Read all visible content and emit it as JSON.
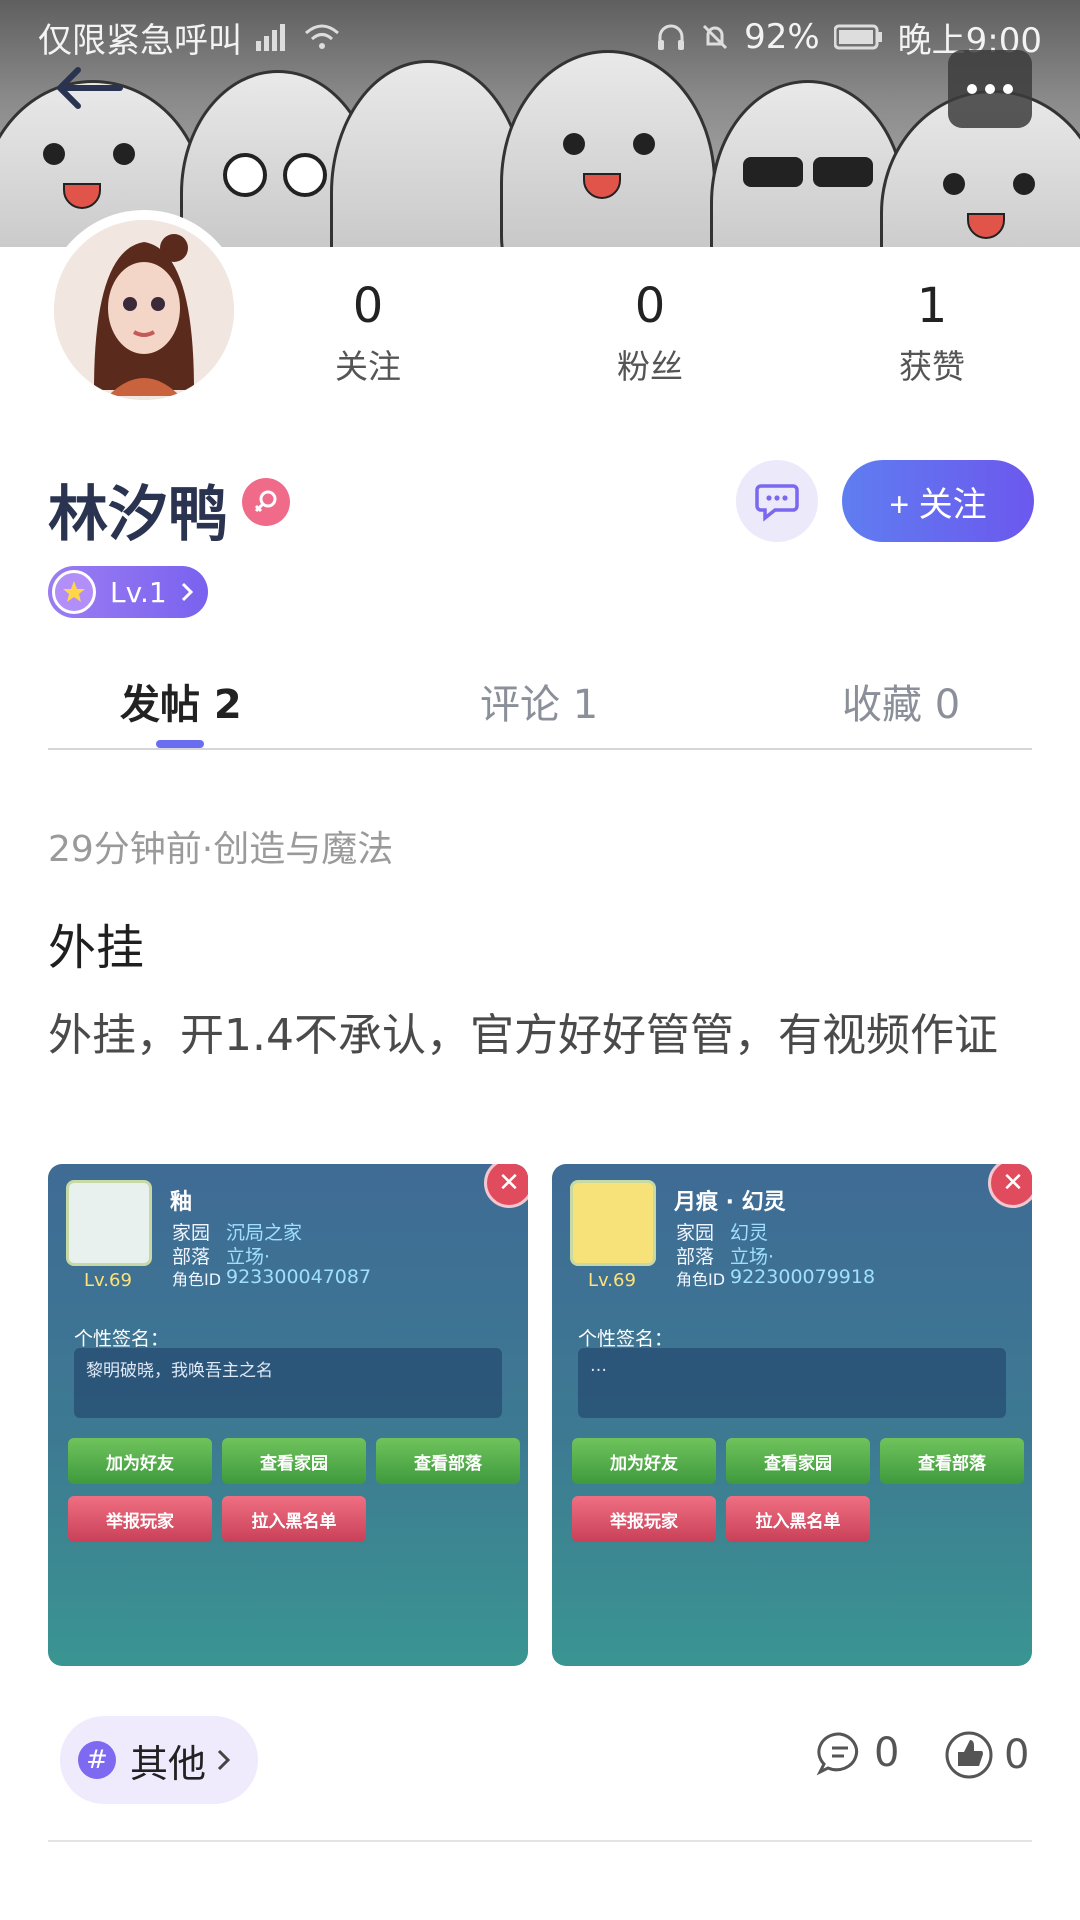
{
  "status_bar": {
    "carrier": "仅限紧急呼叫",
    "battery": "92%",
    "time": "晚上9:00"
  },
  "profile": {
    "username": "林汐鸭",
    "level": "Lv.1",
    "stats": [
      {
        "value": "0",
        "label": "关注"
      },
      {
        "value": "0",
        "label": "粉丝"
      },
      {
        "value": "1",
        "label": "获赞"
      }
    ],
    "follow_label": "+ 关注"
  },
  "tabs": [
    {
      "label": "发帖 2",
      "active": true
    },
    {
      "label": "评论 1",
      "active": false
    },
    {
      "label": "收藏 0",
      "active": false
    }
  ],
  "post": {
    "meta": "29分钟前·创造与魔法",
    "title": "外挂",
    "body": "外挂，开1.4不承认，官方好好管管，有视频作证",
    "images": [
      {
        "name": "釉",
        "home_label": "家园",
        "home": "沉局之家",
        "tribe_label": "部落",
        "tribe": "立场·",
        "role_id_label": "角色ID",
        "role_id": "923300047087",
        "level": "Lv.69",
        "sign_label": "个性签名：",
        "sign": "黎明破晓，我唤吾主之名",
        "buttons": [
          "加为好友",
          "查看家园",
          "查看部落",
          "举报玩家",
          "拉入黑名单"
        ]
      },
      {
        "name": "月痕 · 幻灵",
        "home_label": "家园",
        "home": "幻灵",
        "tribe_label": "部落",
        "tribe": "立场·",
        "role_id_label": "角色ID",
        "role_id": "922300079918",
        "level": "Lv.69",
        "sign_label": "个性签名：",
        "sign": "…",
        "buttons": [
          "加为好友",
          "查看家园",
          "查看部落",
          "举报玩家",
          "拉入黑名单"
        ]
      }
    ],
    "tag": "其他",
    "comments": "0",
    "likes": "0"
  },
  "colors": {
    "accent": "#6b6df0",
    "follow_gradient_start": "#5f7df0",
    "follow_gradient_end": "#6c58ee",
    "gender_badge": "#f06b8a",
    "username": "#2a3350"
  }
}
